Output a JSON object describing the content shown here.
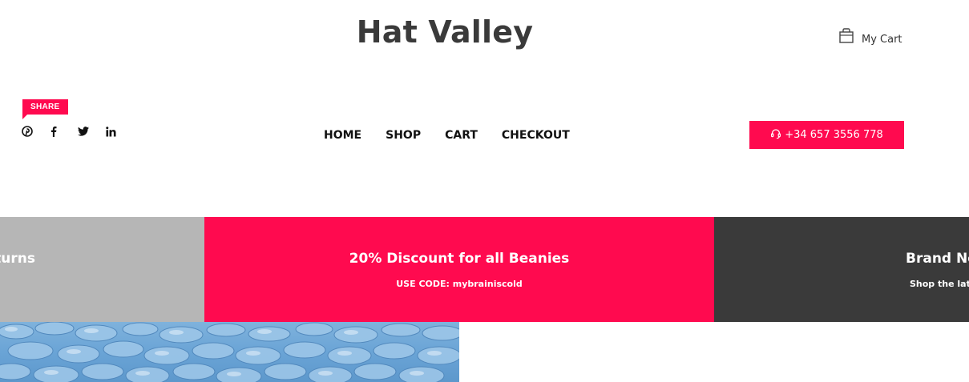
{
  "header": {
    "site_title": "Hat Valley",
    "cart_label": "My Cart"
  },
  "share": {
    "label": "SHARE",
    "icons": [
      "pinterest-icon",
      "facebook-icon",
      "twitter-icon",
      "linkedin-icon"
    ]
  },
  "nav": {
    "items": [
      {
        "label": "HOME"
      },
      {
        "label": "SHOP"
      },
      {
        "label": "CART"
      },
      {
        "label": "CHECKOUT"
      }
    ]
  },
  "contact": {
    "phone": "+34 657 3556 778",
    "icon": "headset-icon"
  },
  "promos": [
    {
      "title": "turns",
      "subtitle": ""
    },
    {
      "title": "20% Discount for all Beanies",
      "subtitle": "USE CODE: mybrainiscold"
    },
    {
      "title": "Brand Ne",
      "subtitle": "Shop the late"
    }
  ],
  "colors": {
    "accent": "#ff0a4f",
    "promo_grey": "#b6b6b6",
    "promo_dark": "#3a3a3a",
    "title_text": "#3a3a3a"
  }
}
